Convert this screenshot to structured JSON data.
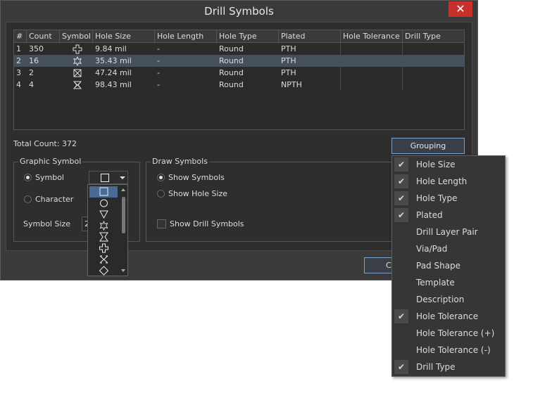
{
  "dialog": {
    "title": "Drill Symbols",
    "close_glyph": "✕"
  },
  "grid": {
    "columns": [
      "#",
      "Count",
      "Symbol",
      "Hole Size",
      "Hole Length",
      "Hole Type",
      "Plated",
      "Hole Tolerance",
      "Drill Type"
    ],
    "rows": [
      {
        "num": "1",
        "count": "350",
        "symbol": "plus-symbol-icon",
        "hole_size": "9.84 mil",
        "hole_length": "-",
        "hole_type": "Round",
        "plated": "PTH"
      },
      {
        "num": "2",
        "count": "16",
        "symbol": "star-symbol-icon",
        "hole_size": "35.43 mil",
        "hole_length": "-",
        "hole_type": "Round",
        "plated": "PTH"
      },
      {
        "num": "3",
        "count": "2",
        "symbol": "cross-box-symbol-icon",
        "hole_size": "47.24 mil",
        "hole_length": "-",
        "hole_type": "Round",
        "plated": "PTH"
      },
      {
        "num": "4",
        "count": "4",
        "symbol": "hourglass-symbol-icon",
        "hole_size": "98.43 mil",
        "hole_length": "-",
        "hole_type": "Round",
        "plated": "NPTH"
      }
    ]
  },
  "total_count": "Total Count: 372",
  "grouping_button": "Grouping",
  "graphic_symbol": {
    "title": "Graphic Symbol",
    "symbol_label": "Symbol",
    "character_label": "Character",
    "symbol_size_label": "Symbol Size",
    "symbol_size_value": "2"
  },
  "draw_symbols": {
    "title": "Draw Symbols",
    "show_symbols": "Show Symbols",
    "show_hole_size": "Show Hole Size",
    "show_drill_symbols": "Show Drill Symbols"
  },
  "grouping_menu": [
    {
      "label": "Hole Size",
      "checked": true
    },
    {
      "label": "Hole Length",
      "checked": true
    },
    {
      "label": "Hole Type",
      "checked": true
    },
    {
      "label": "Plated",
      "checked": true
    },
    {
      "label": "Drill Layer Pair",
      "checked": false
    },
    {
      "label": "Via/Pad",
      "checked": false
    },
    {
      "label": "Pad Shape",
      "checked": false
    },
    {
      "label": "Template",
      "checked": false
    },
    {
      "label": "Description",
      "checked": false
    },
    {
      "label": "Hole Tolerance",
      "checked": true
    },
    {
      "label": "Hole Tolerance (+)",
      "checked": false
    },
    {
      "label": "Hole Tolerance (-)",
      "checked": false
    },
    {
      "label": "Drill Type",
      "checked": true
    }
  ],
  "check_glyph": "✔",
  "ok_partial": "C"
}
